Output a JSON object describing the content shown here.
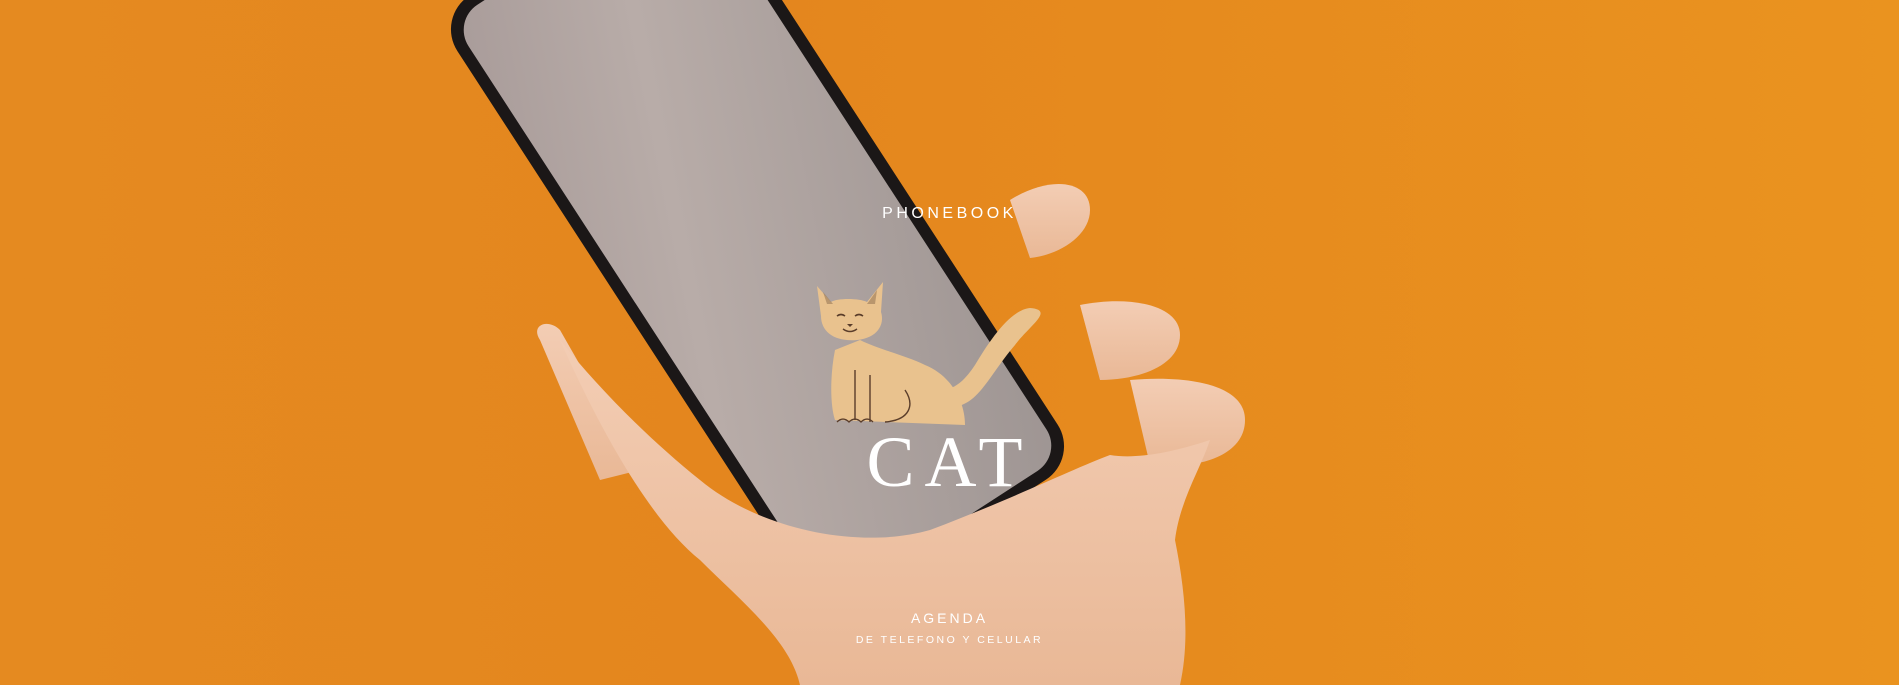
{
  "cover": {
    "brand": "PHONEBOOK",
    "title": "CAT",
    "subtitle": "AGENDA",
    "tagline": "DE TELEFONO Y CELULAR"
  },
  "colors": {
    "background": "#e58a20",
    "phone_screen": "#b2a7a4",
    "phone_frame": "#1b1717",
    "skin": "#f0c6a8",
    "cat": "#e9c28e",
    "text": "#ffffff"
  },
  "icons": [
    "cat-illustration"
  ]
}
